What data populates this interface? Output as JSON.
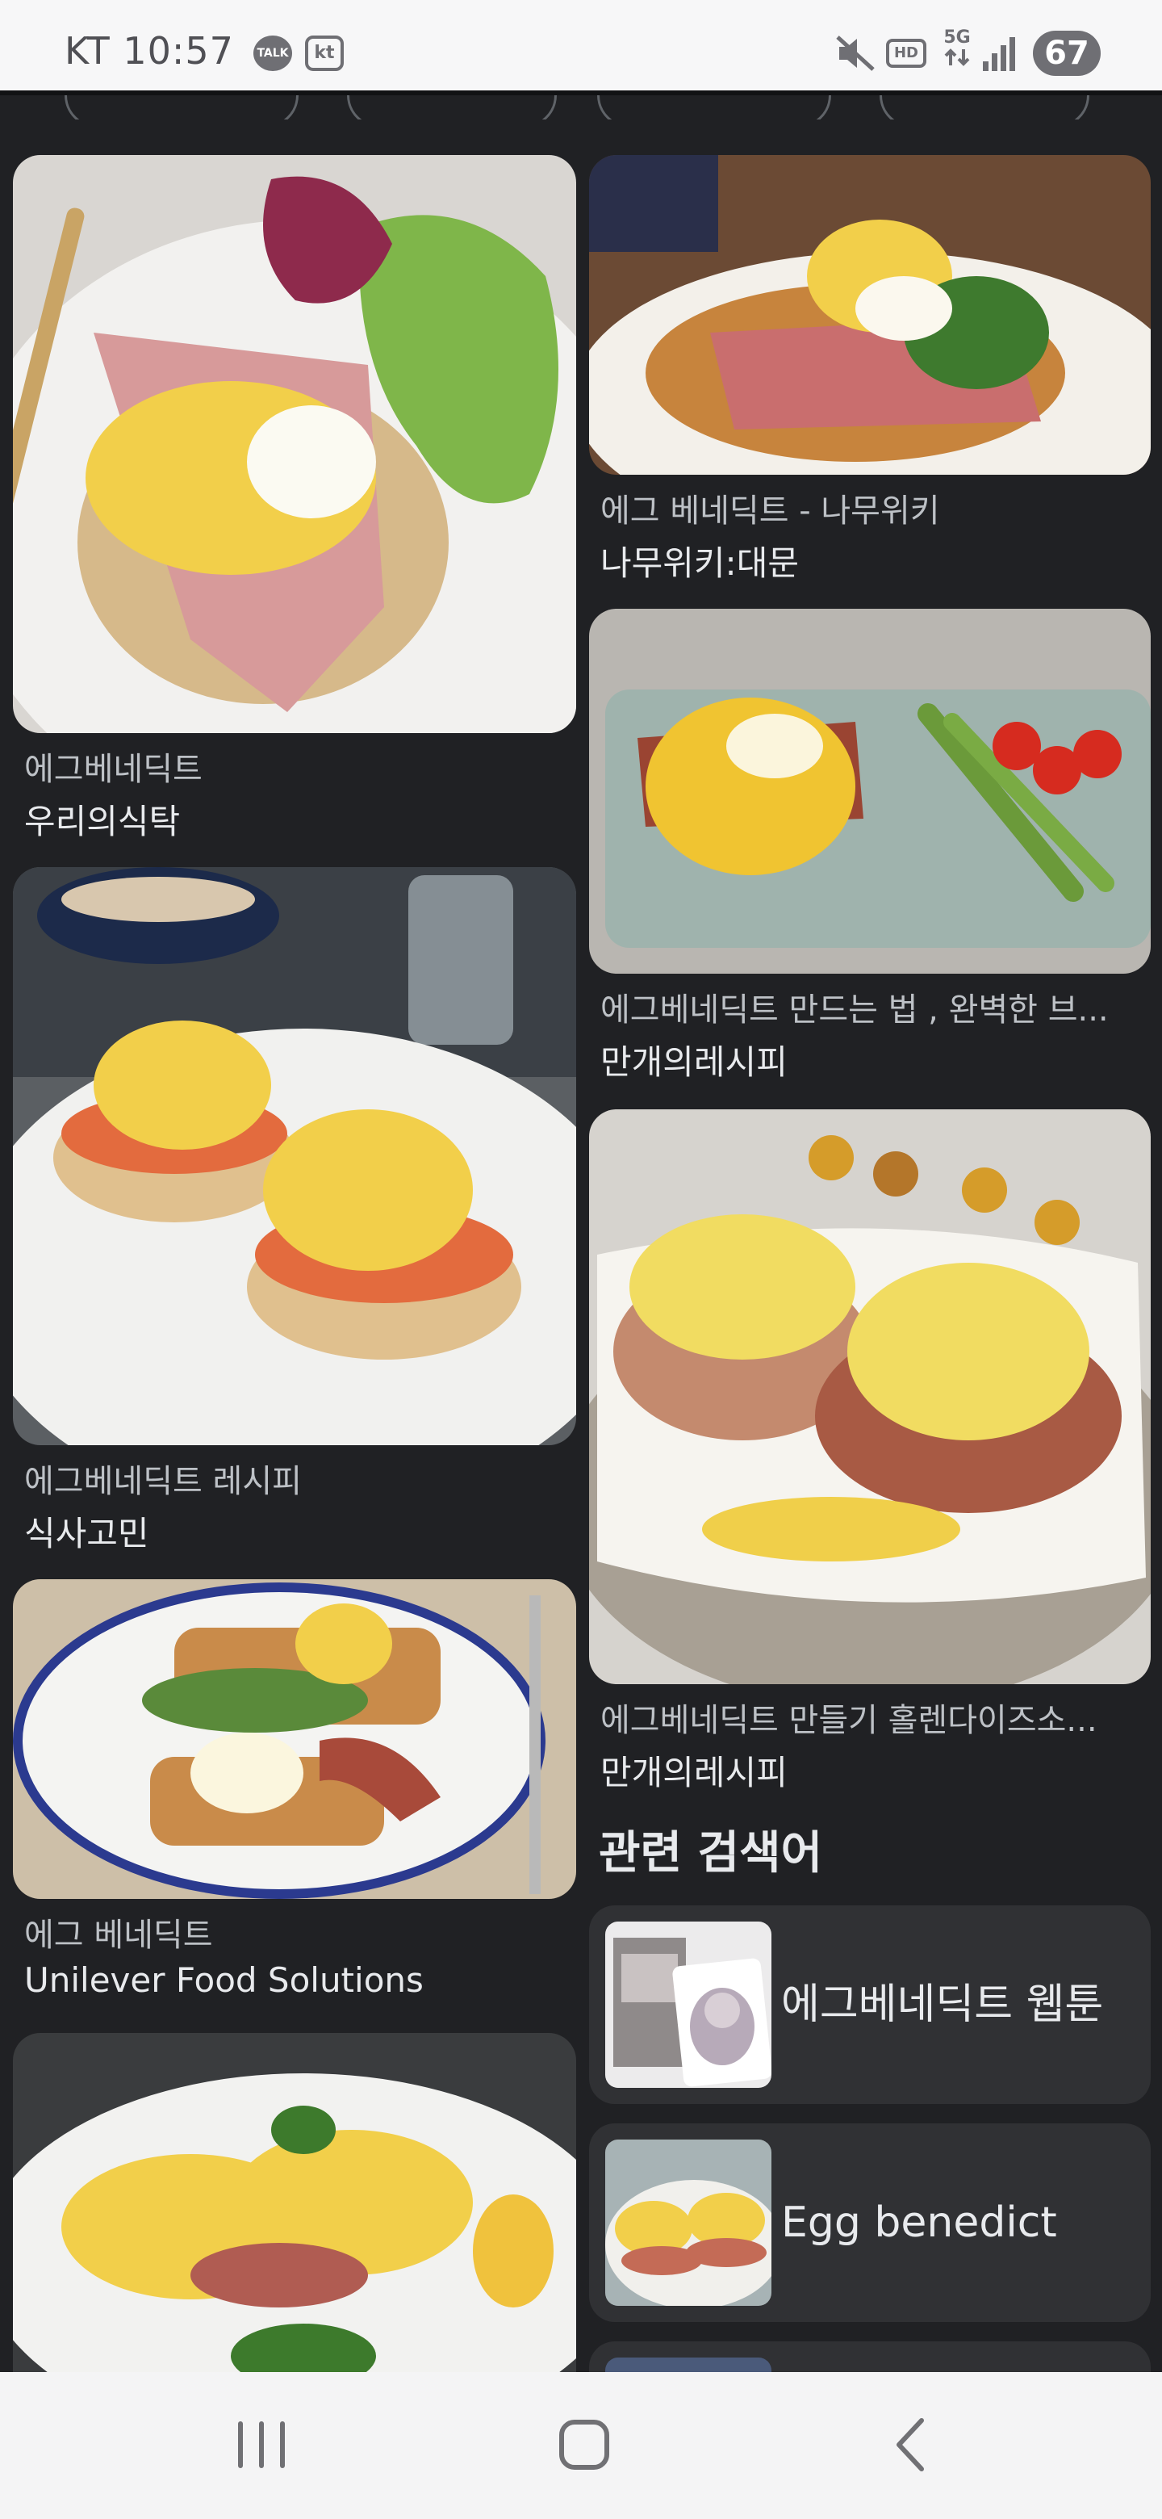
{
  "status_bar": {
    "carrier_time": "KT 10:57",
    "talk_label": "TALK",
    "kt_label": "kt",
    "hd_label": "HD",
    "network_label": "5G",
    "battery": "67"
  },
  "results": [
    {
      "title": "에그베네딕트",
      "source": "우리의식탁"
    },
    {
      "title": "에그 베네딕트 - 나무위키",
      "source": "나무위키:대문"
    },
    {
      "title": "에그베네딕트 만드는 법 , 완벽한 브...",
      "source": "만개의레시피"
    },
    {
      "title": "에그베네딕트 레시피",
      "source": "식사고민"
    },
    {
      "title": "에그베네딕트 만들기 홀렌다이즈소...",
      "source": "만개의레시피"
    },
    {
      "title": "에그 베네딕트",
      "source": "Unilever Food Solutions"
    }
  ],
  "related": {
    "heading": "관련 검색어",
    "items": [
      {
        "label": "에그베네딕트 웹툰"
      },
      {
        "label": "Egg benedict"
      }
    ]
  },
  "icons": {
    "talk": "kakaotalk-icon",
    "kt": "kt-icon",
    "mute": "mute-icon",
    "signal": "signal-icon",
    "recents": "recents-icon",
    "home": "home-icon",
    "back": "back-icon"
  },
  "colors": {
    "background": "#202124",
    "card": "#303134",
    "hollandaise": "#f2cf4a",
    "status_bar": "#f7f7f8"
  }
}
